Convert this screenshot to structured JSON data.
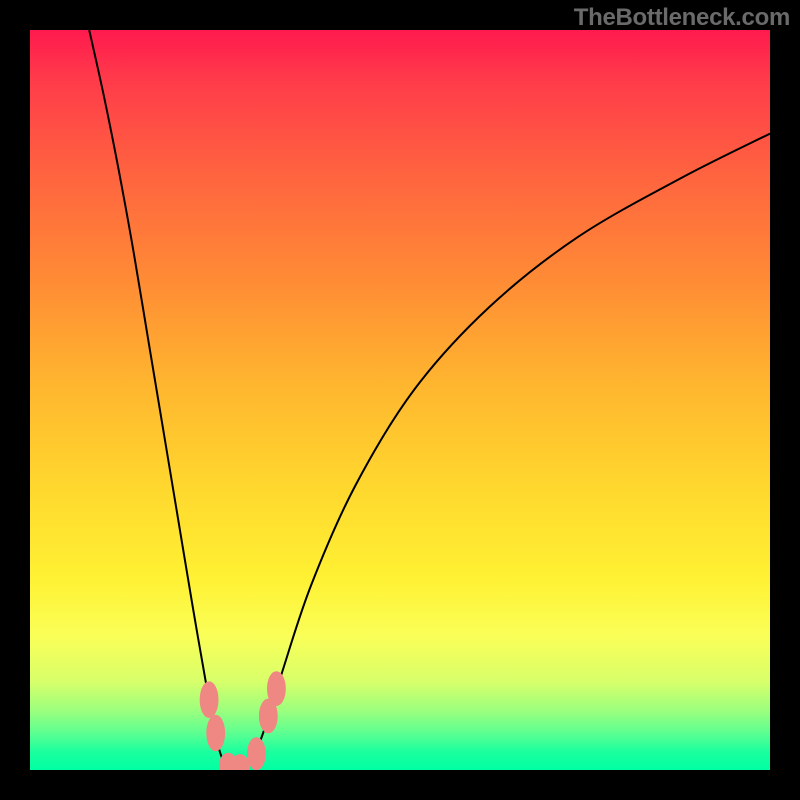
{
  "watermark": "TheBottleneck.com",
  "colors": {
    "frame_bg": "#000000",
    "gradient_css": "linear-gradient(to bottom, #ff1a4e 0%, #ff3c4a 7%, #ff653f 20%, #ff8c35 34%, #ffb62f 48%, #ffd82e 62%, #fff133 74%, #faff58 82%, #d8ff6a 88%, #9bff7e 92%, #5dff91 95%, #1cff9e 97.5%, #00ffa3 100%)",
    "curve_stroke": "#000000",
    "marker_fill": "#ef8783"
  },
  "chart_data": {
    "type": "line",
    "title": "",
    "xlabel": "",
    "ylabel": "",
    "x_range": [
      0,
      100
    ],
    "y_range": [
      0,
      100
    ],
    "note": "Bottleneck-style chart: one V-shaped curve reaching the bottom (y≈0) near x≈27 and spanning full height at both sides. Background color encodes bottleneck severity (red=high, green=low). No axis ticks or labels are rendered.",
    "series": [
      {
        "name": "bottleneck-curve",
        "points": [
          {
            "x": 8.0,
            "y": 100.0
          },
          {
            "x": 10.0,
            "y": 91.0
          },
          {
            "x": 12.0,
            "y": 81.0
          },
          {
            "x": 14.0,
            "y": 70.0
          },
          {
            "x": 16.0,
            "y": 58.0
          },
          {
            "x": 18.0,
            "y": 46.0
          },
          {
            "x": 20.0,
            "y": 34.0
          },
          {
            "x": 22.0,
            "y": 22.0
          },
          {
            "x": 24.0,
            "y": 10.5
          },
          {
            "x": 25.0,
            "y": 5.0
          },
          {
            "x": 26.0,
            "y": 1.5
          },
          {
            "x": 27.0,
            "y": 0.3
          },
          {
            "x": 28.5,
            "y": 0.3
          },
          {
            "x": 30.0,
            "y": 1.5
          },
          {
            "x": 31.5,
            "y": 5.0
          },
          {
            "x": 34.0,
            "y": 13.0
          },
          {
            "x": 38.0,
            "y": 25.0
          },
          {
            "x": 44.0,
            "y": 38.5
          },
          {
            "x": 52.0,
            "y": 51.5
          },
          {
            "x": 62.0,
            "y": 62.5
          },
          {
            "x": 74.0,
            "y": 72.0
          },
          {
            "x": 88.0,
            "y": 80.0
          },
          {
            "x": 100.0,
            "y": 86.0
          }
        ]
      }
    ],
    "markers": [
      {
        "name": "left-upper",
        "x": 24.2,
        "y": 9.5,
        "r": 1.2,
        "stretch": 2.0
      },
      {
        "name": "left-lower",
        "x": 25.1,
        "y": 5.0,
        "r": 1.2,
        "stretch": 2.0
      },
      {
        "name": "bottom-left",
        "x": 26.8,
        "y": 0.6,
        "r": 1.2,
        "stretch": 1.4
      },
      {
        "name": "bottom-mid",
        "x": 28.4,
        "y": 0.4,
        "r": 1.2,
        "stretch": 1.4
      },
      {
        "name": "bottom-right",
        "x": 30.6,
        "y": 2.2,
        "r": 1.2,
        "stretch": 1.8
      },
      {
        "name": "right-lower",
        "x": 32.2,
        "y": 7.3,
        "r": 1.2,
        "stretch": 1.9
      },
      {
        "name": "right-upper",
        "x": 33.3,
        "y": 11.0,
        "r": 1.2,
        "stretch": 1.9
      }
    ]
  }
}
